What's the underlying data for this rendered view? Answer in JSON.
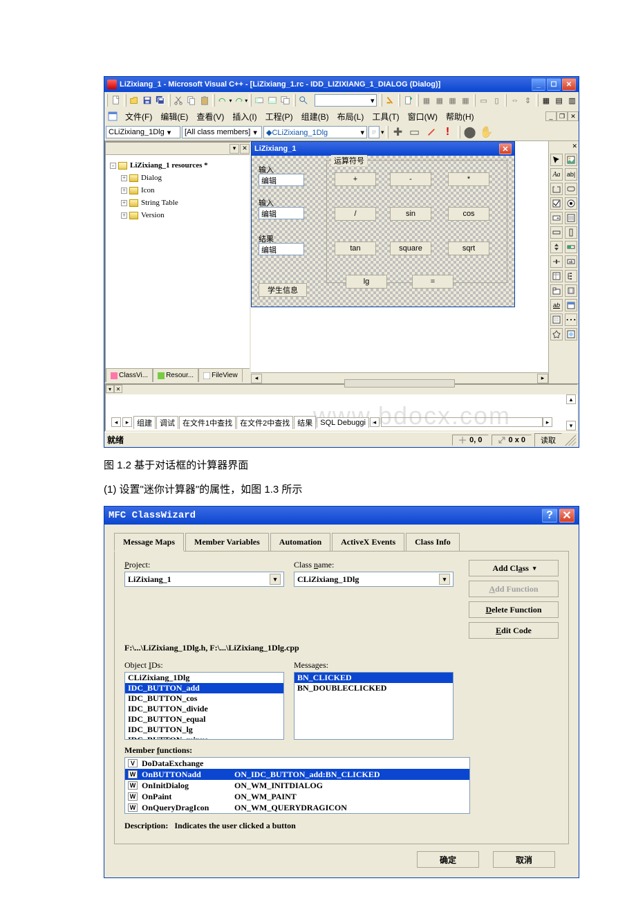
{
  "ide": {
    "title": "LiZixiang_1 - Microsoft Visual C++ - [LiZixiang_1.rc - IDD_LIZIXIANG_1_DIALOG (Dialog)]",
    "menu": {
      "file": "文件(F)",
      "edit": "编辑(E)",
      "view": "查看(V)",
      "insert": "插入(I)",
      "project": "工程(P)",
      "build": "组建(B)",
      "layout": "布局(L)",
      "tools": "工具(T)",
      "window": "窗口(W)",
      "help": "帮助(H)"
    },
    "wizbar": {
      "class": "CLiZixiang_1Dlg",
      "filter": "[All class members]",
      "member": "◆CLiZixiang_1Dlg"
    },
    "tree": {
      "root": "LiZixiang_1 resources *",
      "nodes": [
        "Dialog",
        "Icon",
        "String Table",
        "Version"
      ]
    },
    "lefttabs": {
      "class": "ClassVi...",
      "resource": "Resour...",
      "file": "FileView"
    },
    "dialog": {
      "title": "LiZixiang_1",
      "labels": {
        "input1": "输入",
        "edit1": "编辑",
        "input2": "输入",
        "edit2": "编辑",
        "result": "结果",
        "edit3": "编辑",
        "group": "运算符号"
      },
      "btns": {
        "add": "+",
        "minus": "-",
        "mul": "*",
        "div": "/",
        "sin": "sin",
        "cos": "cos",
        "tan": "tan",
        "square": "square",
        "sqrt": "sqrt",
        "lg": "lg",
        "eq": "=",
        "student": "学生信息"
      }
    },
    "output": {
      "tabs": {
        "build": "组建",
        "debug": "调试",
        "find1": "在文件1中查找",
        "find2": "在文件2中查找",
        "results": "结果",
        "sql": "SQL Debuggi"
      },
      "watermark": "www.bdocx.com"
    },
    "status": {
      "ready": "就绪",
      "pos": "0, 0",
      "size": "0 x 0",
      "read": "读取"
    }
  },
  "captions": {
    "fig": "图 1.2 基于对话框的计算器界面",
    "step": "(1) 设置\"迷你计算器\"的属性，如图 1.3 所示"
  },
  "cw": {
    "title": "MFC ClassWizard",
    "tabs": {
      "maps": "Message Maps",
      "vars": "Member Variables",
      "auto": "Automation",
      "activex": "ActiveX Events",
      "info": "Class Info"
    },
    "labels": {
      "project": "Project:",
      "classname": "Class name:",
      "objectids": "Object IDs:",
      "messages": "Messages:",
      "memberfunc": "Member functions:",
      "desc": "Description:"
    },
    "project": "LiZixiang_1",
    "classname": "CLiZixiang_1Dlg",
    "path": "F:\\...\\LiZixiang_1Dlg.h, F:\\...\\LiZixiang_1Dlg.cpp",
    "objects": [
      "CLiZixiang_1Dlg",
      "IDC_BUTTON_add",
      "IDC_BUTTON_cos",
      "IDC_BUTTON_divide",
      "IDC_BUTTON_equal",
      "IDC_BUTTON_lg",
      "IDC_BUTTON_minus"
    ],
    "objects_sel_index": 1,
    "messages": [
      "BN_CLICKED",
      "BN_DOUBLECLICKED"
    ],
    "messages_sel_index": 0,
    "members": [
      {
        "tag": "V",
        "name": "DoDataExchange",
        "msg": ""
      },
      {
        "tag": "W",
        "name": "OnBUTTONadd",
        "msg": "ON_IDC_BUTTON_add:BN_CLICKED"
      },
      {
        "tag": "W",
        "name": "OnInitDialog",
        "msg": "ON_WM_INITDIALOG"
      },
      {
        "tag": "W",
        "name": "OnPaint",
        "msg": "ON_WM_PAINT"
      },
      {
        "tag": "W",
        "name": "OnQueryDragIcon",
        "msg": "ON_WM_QUERYDRAGICON"
      }
    ],
    "members_sel_index": 1,
    "desc_text": "Indicates the user clicked a button",
    "btns": {
      "addclass": "Add Class",
      "addfunc": "Add Function",
      "delfunc": "Delete Function",
      "editcode": "Edit Code",
      "ok": "确定",
      "cancel": "取消"
    }
  }
}
